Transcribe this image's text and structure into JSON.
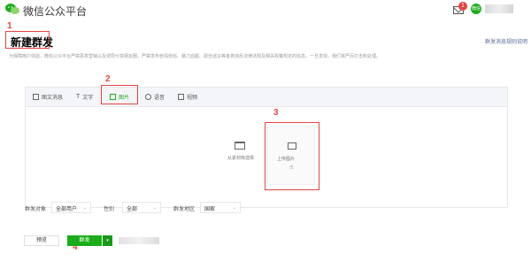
{
  "header": {
    "brand": "微信公众平台",
    "notification_count": "1",
    "user_badge_text": "微信号"
  },
  "page": {
    "title": "新建群发",
    "help_link": "群发消息规则说明",
    "notice": "为保障用户体验，微信公众平台严禁恶意营销以及诱导分享朋友圈，严禁发布色情低俗、暴力血腥、政治谣言等各类违反法律法规及相关政策规定的信息。一旦发现，我们将严厉打击和处理。"
  },
  "annotations": {
    "step1": "1",
    "step2": "2",
    "step3": "3",
    "step4": "4"
  },
  "tabs": [
    {
      "label": "图文消息",
      "icon": "article-icon"
    },
    {
      "label": "文字",
      "icon": "text-icon"
    },
    {
      "label": "图片",
      "icon": "image-icon",
      "active": true
    },
    {
      "label": "语音",
      "icon": "audio-icon"
    },
    {
      "label": "视频",
      "icon": "video-icon"
    }
  ],
  "upload": {
    "from_library": "从素材库选择",
    "upload_image": "上传图片"
  },
  "filters": {
    "target_label": "群发对象",
    "target_value": "全部用户",
    "gender_label": "性别",
    "gender_value": "全部",
    "region_label": "群发地区",
    "region_value": "国家"
  },
  "actions": {
    "preview": "预览",
    "send": "群发"
  },
  "colors": {
    "accent": "#1aad19",
    "annotation": "#e64340",
    "link": "#576b95"
  }
}
